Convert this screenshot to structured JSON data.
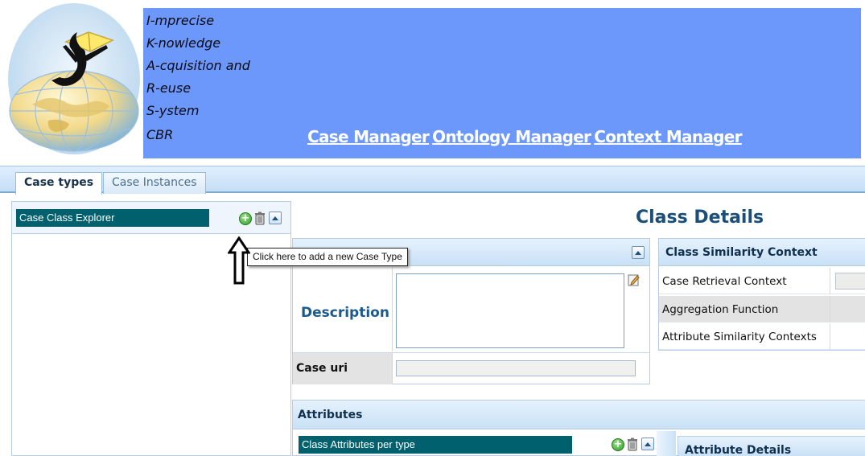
{
  "header": {
    "acronym_lines": [
      "I-mprecise",
      "K-nowledge",
      "A-cquisition and",
      "R-euse",
      "S-ystem",
      "CBR"
    ],
    "nav": [
      "Case Manager",
      "Ontology Manager",
      "Context Manager"
    ],
    "header_color": "#6b98fa"
  },
  "tabs": {
    "case_types": "Case types",
    "case_instances": "Case Instances"
  },
  "left_panel": {
    "title": "Case Class Explorer",
    "icons": [
      "add-icon",
      "trash-icon",
      "collapse-up-icon"
    ]
  },
  "tooltip": "Click here to add a new Case Type",
  "class_details": {
    "title": "Class Details",
    "description_label": "Description",
    "description_value": "",
    "case_uri_label": "Case uri",
    "case_uri_value": ""
  },
  "similarity": {
    "title": "Class Similarity Context",
    "rows": [
      "Case Retrieval Context",
      "Aggregation Function",
      "Attribute Similarity Contexts"
    ]
  },
  "attributes": {
    "title": "Attributes",
    "sub_title": "Class Attributes per type",
    "details_title": "Attribute Details"
  },
  "colors": {
    "accent_teal": "#00606d",
    "title_blue": "#1b4f7a"
  }
}
